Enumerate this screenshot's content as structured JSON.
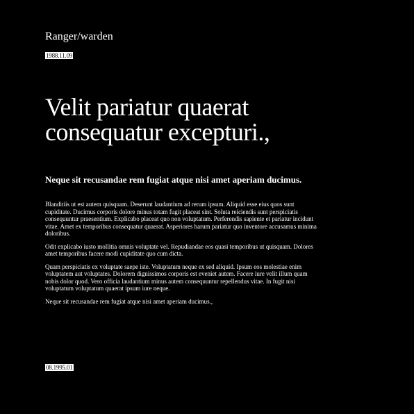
{
  "header": {
    "site_title": "Ranger/warden",
    "date": "1988.11.09"
  },
  "article": {
    "headline": "Velit pariatur quaerat consequatur excepturi.,",
    "subheading": "Neque sit recusandae rem fugiat atque nisi amet aperiam ducimus.",
    "paragraphs": [
      "Blanditiis ut est autem quisquam. Deserunt laudantium ad rerum ipsum. Aliquid esse eius quos sunt cupiditate. Ducimus corporis dolore minus totam fugit placeat sint. Soluta reiciendis sunt perspiciatis consequuntur praesentium. Explicabo placeat quo non voluptatum. Perferendis sapiente et pariatur incidunt vitae. Amet ex temporibus consequatur quaerat. Asperiores harum pariatur quo inventore accusamus minima doloribus.",
      "Odit explicabo iusto mollitia omnis voluptate vel. Repudiandae eos quasi temporibus ut quisquam. Dolores amet temporibus facere modi cupiditate quo cum dicta.",
      "Quam perspiciatis ex voluptate saepe iste. Voluptatum neque ex sed aliquid. Ipsum eos molestiae enim voluptatem aut voluptates. Dolorem dignissimos corporis est eveniet autem. Facere iure velit illum quam nobis dolor quod. Vero officia laudantium minus autem consequuntur repellendus vitae. In fugit nisi voluptatum voluptatum quaerat ipsum iure neque.",
      "Neque sit recusandae rem fugiat atque nisi amet aperiam ducimus.,"
    ]
  },
  "footer": {
    "date": "08.1995.01"
  },
  "colors": {
    "background": "#000000",
    "text": "#ffffff",
    "tag_background": "#ffffff",
    "tag_text": "#000000"
  }
}
